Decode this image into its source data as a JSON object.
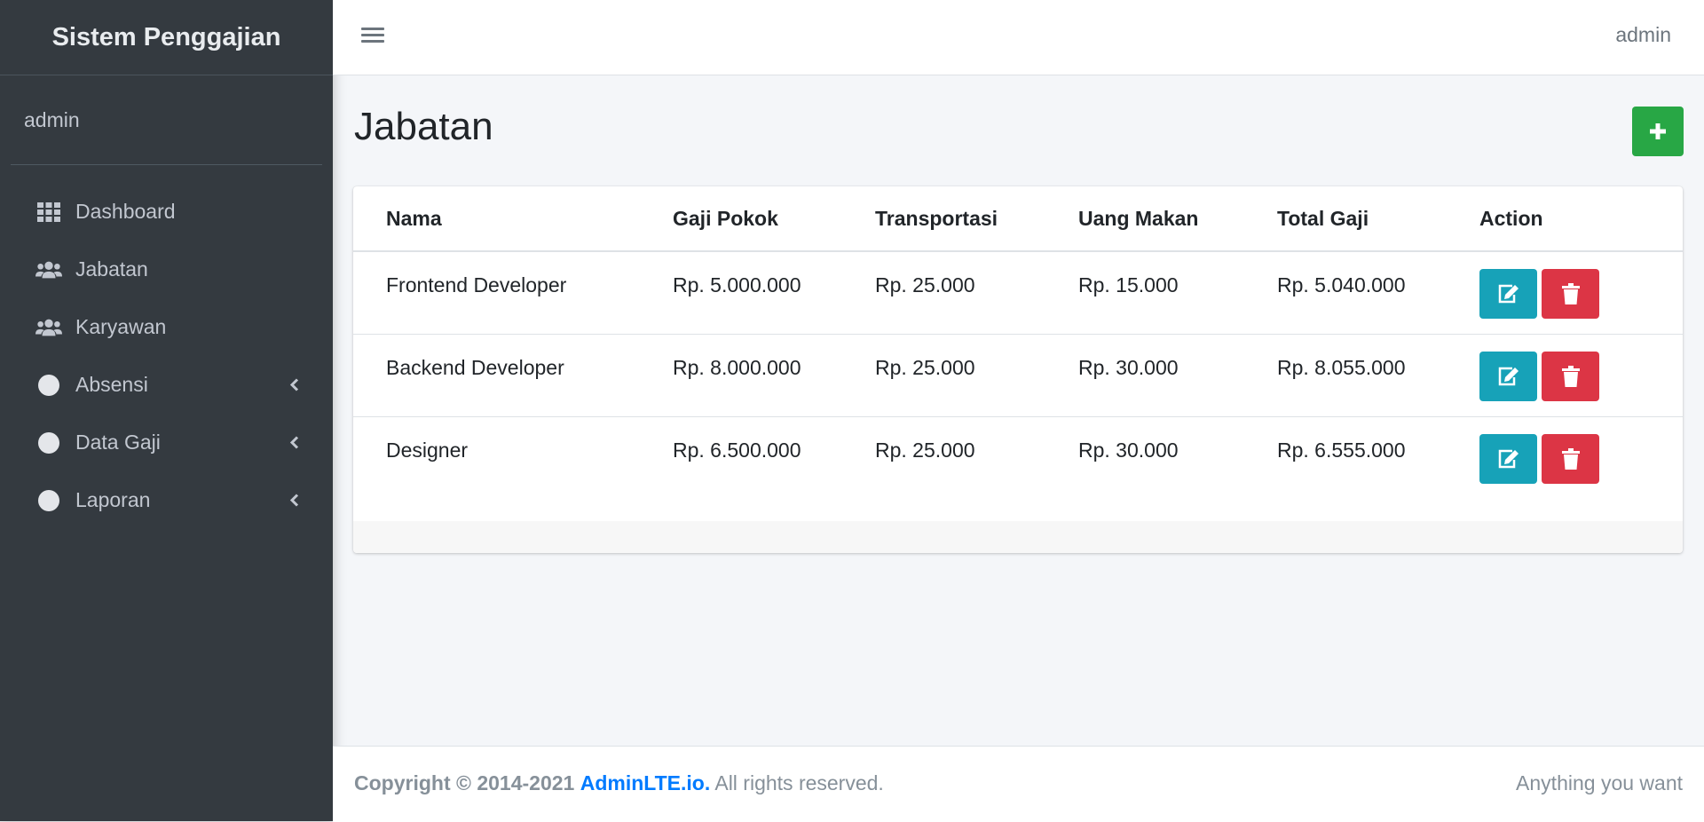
{
  "brand": {
    "title": "Sistem Penggajian"
  },
  "sidebar": {
    "user": "admin",
    "items": [
      {
        "label": "Dashboard",
        "icon": "grid-icon"
      },
      {
        "label": "Jabatan",
        "icon": "users-icon"
      },
      {
        "label": "Karyawan",
        "icon": "users-icon"
      },
      {
        "label": "Absensi",
        "icon": "circle-icon",
        "has_submenu": true
      },
      {
        "label": "Data Gaji",
        "icon": "circle-icon",
        "has_submenu": true
      },
      {
        "label": "Laporan",
        "icon": "circle-icon",
        "has_submenu": true
      }
    ]
  },
  "topbar": {
    "user": "admin"
  },
  "page": {
    "title": "Jabatan",
    "add_icon": "plus-icon"
  },
  "table": {
    "headers": [
      "Nama",
      "Gaji Pokok",
      "Transportasi",
      "Uang Makan",
      "Total Gaji",
      "Action"
    ],
    "rows": [
      [
        "Frontend Developer",
        "Rp. 5.000.000",
        "Rp. 25.000",
        "Rp. 15.000",
        "Rp. 5.040.000"
      ],
      [
        "Backend Developer",
        "Rp. 8.000.000",
        "Rp. 25.000",
        "Rp. 30.000",
        "Rp. 8.055.000"
      ],
      [
        "Designer",
        "Rp. 6.500.000",
        "Rp. 25.000",
        "Rp. 30.000",
        "Rp. 6.555.000"
      ]
    ]
  },
  "footer": {
    "copyright": "Copyright © 2014-2021",
    "link": "AdminLTE.io.",
    "rights": "All rights reserved.",
    "right_text": "Anything you want"
  },
  "colors": {
    "sidebar_bg": "#343a40",
    "add": "#28a745",
    "edit": "#17a2b8",
    "delete": "#dc3545",
    "link": "#007bff"
  }
}
